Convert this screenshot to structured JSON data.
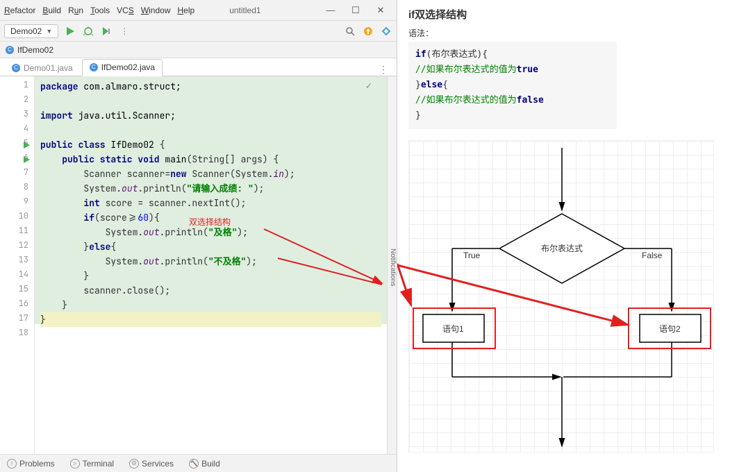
{
  "menubar": {
    "items": [
      "Refactor",
      "Build",
      "Run",
      "Tools",
      "VCS",
      "Window",
      "Help"
    ],
    "underline_idx": [
      0,
      0,
      1,
      0,
      2,
      0,
      0
    ],
    "project_title": "untitled1"
  },
  "toolbar": {
    "run_config": "Demo02",
    "icons": {
      "run": "run-icon",
      "debug": "debug-icon",
      "stop": "stop-icon",
      "more": "more-icon"
    }
  },
  "breadcrumb": {
    "file_label": "IfDemo02"
  },
  "tabs": [
    {
      "label": "Demo01.java",
      "active": false
    },
    {
      "label": "IfDemo02.java",
      "active": true
    }
  ],
  "code_lines": [
    {
      "n": 1,
      "parts": [
        {
          "t": "package ",
          "c": "kw"
        },
        {
          "t": "com.almaro.struct;",
          "c": "pkg"
        }
      ]
    },
    {
      "n": 2,
      "parts": []
    },
    {
      "n": 3,
      "parts": [
        {
          "t": "import ",
          "c": "kw"
        },
        {
          "t": "java.util.Scanner;",
          "c": "pkg"
        }
      ]
    },
    {
      "n": 4,
      "parts": []
    },
    {
      "n": 5,
      "run": true,
      "parts": [
        {
          "t": "public class ",
          "c": "kw"
        },
        {
          "t": "IfDemo02 ",
          "c": "cls"
        },
        {
          "t": "{",
          "c": ""
        }
      ]
    },
    {
      "n": 6,
      "run": true,
      "parts": [
        {
          "t": "    ",
          "c": ""
        },
        {
          "t": "public static void ",
          "c": "kw"
        },
        {
          "t": "main",
          "c": "cls"
        },
        {
          "t": "(String[] args) {",
          "c": ""
        }
      ]
    },
    {
      "n": 7,
      "parts": [
        {
          "t": "        Scanner scanner=",
          "c": ""
        },
        {
          "t": "new ",
          "c": "kw"
        },
        {
          "t": "Scanner(System.",
          "c": ""
        },
        {
          "t": "in",
          "c": "fld"
        },
        {
          "t": ");",
          "c": ""
        }
      ]
    },
    {
      "n": 8,
      "parts": [
        {
          "t": "        System.",
          "c": ""
        },
        {
          "t": "out",
          "c": "fld"
        },
        {
          "t": ".println(",
          "c": ""
        },
        {
          "t": "\"请输入成绩: \"",
          "c": "str"
        },
        {
          "t": ");",
          "c": ""
        }
      ]
    },
    {
      "n": 9,
      "parts": [
        {
          "t": "        ",
          "c": ""
        },
        {
          "t": "int ",
          "c": "kw"
        },
        {
          "t": "score = scanner.nextInt();",
          "c": ""
        }
      ]
    },
    {
      "n": 10,
      "parts": [
        {
          "t": "        ",
          "c": ""
        },
        {
          "t": "if",
          "c": "kw"
        },
        {
          "t": "(score>=",
          "c": ""
        },
        {
          "t": "60",
          "c": "num"
        },
        {
          "t": "){",
          "c": ""
        }
      ]
    },
    {
      "n": 11,
      "parts": [
        {
          "t": "            System.",
          "c": ""
        },
        {
          "t": "out",
          "c": "fld"
        },
        {
          "t": ".println(",
          "c": ""
        },
        {
          "t": "\"及格\"",
          "c": "str"
        },
        {
          "t": ");",
          "c": ""
        }
      ]
    },
    {
      "n": 12,
      "parts": [
        {
          "t": "        }",
          "c": ""
        },
        {
          "t": "else",
          "c": "kw"
        },
        {
          "t": "{",
          "c": ""
        }
      ]
    },
    {
      "n": 13,
      "parts": [
        {
          "t": "            System.",
          "c": ""
        },
        {
          "t": "out",
          "c": "fld"
        },
        {
          "t": ".println(",
          "c": ""
        },
        {
          "t": "\"不及格\"",
          "c": "str"
        },
        {
          "t": ");",
          "c": ""
        }
      ]
    },
    {
      "n": 14,
      "parts": [
        {
          "t": "        }",
          "c": ""
        }
      ]
    },
    {
      "n": 15,
      "parts": [
        {
          "t": "        scanner.close();",
          "c": ""
        }
      ]
    },
    {
      "n": 16,
      "parts": [
        {
          "t": "    }",
          "c": ""
        }
      ]
    },
    {
      "n": 17,
      "hl": true,
      "parts": [
        {
          "t": "}",
          "c": ""
        }
      ]
    },
    {
      "n": 18,
      "parts": []
    }
  ],
  "annotation_label": "双选择结构",
  "side_strip": "Notifications",
  "bottom_tools": [
    "Problems",
    "Terminal",
    "Services",
    "Build"
  ],
  "right": {
    "title": "if双选择结构",
    "syntax_label": "语法：",
    "code": {
      "l1": {
        "a": "if",
        "b": "(布尔表达式){"
      },
      "l2": {
        "a": "    //如果布尔表达式的值为",
        "b": "true"
      },
      "l3": {
        "a": "}",
        "b": "else",
        "c": "{"
      },
      "l4": {
        "a": "    //如果布尔表达式的值为",
        "b": "false"
      },
      "l5": "}"
    },
    "diagram": {
      "condition": "布尔表达式",
      "true_label": "True",
      "false_label": "False",
      "stmt1": "语句1",
      "stmt2": "语句2"
    }
  }
}
